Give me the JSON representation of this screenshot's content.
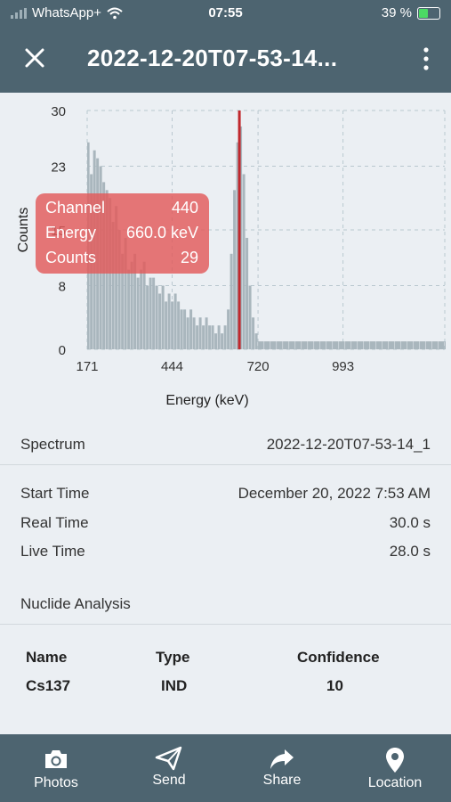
{
  "status_bar": {
    "carrier": "WhatsApp+",
    "time": "07:55",
    "battery": "39 %"
  },
  "app_bar": {
    "title": "2022-12-20T07-53-14..."
  },
  "chart_data": {
    "type": "bar",
    "xlabel": "Energy (keV)",
    "ylabel": "Counts",
    "xtick_labels": [
      "171",
      "444",
      "720",
      "993"
    ],
    "ytick_labels": [
      "30",
      "23",
      "15",
      "8",
      "0"
    ],
    "ylim": [
      0,
      30
    ],
    "xlim": [
      171,
      1320
    ],
    "grid": true,
    "marker_energy_kev": 660,
    "colors": {
      "bars": "#a9b6bd",
      "marker": "#c0282d",
      "grid": "#b9c8cf"
    },
    "x": [
      171,
      180,
      190,
      200,
      210,
      220,
      230,
      240,
      250,
      260,
      270,
      280,
      290,
      300,
      310,
      320,
      330,
      340,
      350,
      360,
      370,
      380,
      390,
      400,
      410,
      420,
      430,
      440,
      450,
      460,
      470,
      480,
      490,
      500,
      510,
      520,
      530,
      540,
      550,
      560,
      570,
      580,
      590,
      600,
      610,
      620,
      630,
      640,
      650,
      660,
      670,
      680,
      690,
      700,
      710,
      720,
      740,
      760,
      780,
      800,
      820,
      840,
      860,
      880,
      900,
      920,
      940,
      960,
      980,
      1000,
      1020,
      1040,
      1060,
      1080,
      1100,
      1120,
      1140,
      1160,
      1180,
      1200,
      1220,
      1240,
      1260,
      1280,
      1300,
      1320
    ],
    "values": [
      26,
      22,
      25,
      24,
      23,
      21,
      20,
      19,
      16,
      18,
      15,
      12,
      14,
      10,
      11,
      12,
      9,
      10,
      11,
      8,
      9,
      9,
      8,
      7,
      8,
      6,
      7,
      6,
      7,
      6,
      5,
      5,
      4,
      5,
      4,
      3,
      4,
      3,
      4,
      3,
      3,
      2,
      3,
      2,
      3,
      5,
      12,
      20,
      26,
      28,
      22,
      14,
      8,
      4,
      2,
      1,
      1,
      1,
      1,
      1,
      1,
      1,
      1,
      1,
      1,
      1,
      1,
      1,
      1,
      1,
      1,
      1,
      1,
      1,
      1,
      1,
      1,
      1,
      1,
      1,
      1,
      1,
      1,
      1,
      1,
      1
    ]
  },
  "tooltip": {
    "channel_label": "Channel",
    "channel_value": "440",
    "energy_label": "Energy",
    "energy_value": "660.0 keV",
    "counts_label": "Counts",
    "counts_value": "29"
  },
  "spectrum": {
    "label": "Spectrum",
    "value": "2022-12-20T07-53-14_1"
  },
  "details": [
    {
      "label": "Start Time",
      "value": "December 20, 2022 7:53 AM"
    },
    {
      "label": "Real Time",
      "value": "30.0 s"
    },
    {
      "label": "Live Time",
      "value": "28.0 s"
    }
  ],
  "nuclide_analysis": {
    "title": "Nuclide Analysis",
    "headers": [
      "Name",
      "Type",
      "Confidence"
    ],
    "rows": [
      [
        "Cs137",
        "IND",
        "10"
      ]
    ]
  },
  "bottom_nav": [
    {
      "label": "Photos",
      "icon": "camera-icon"
    },
    {
      "label": "Send",
      "icon": "send-icon"
    },
    {
      "label": "Share",
      "icon": "share-icon"
    },
    {
      "label": "Location",
      "icon": "location-pin-icon"
    }
  ]
}
